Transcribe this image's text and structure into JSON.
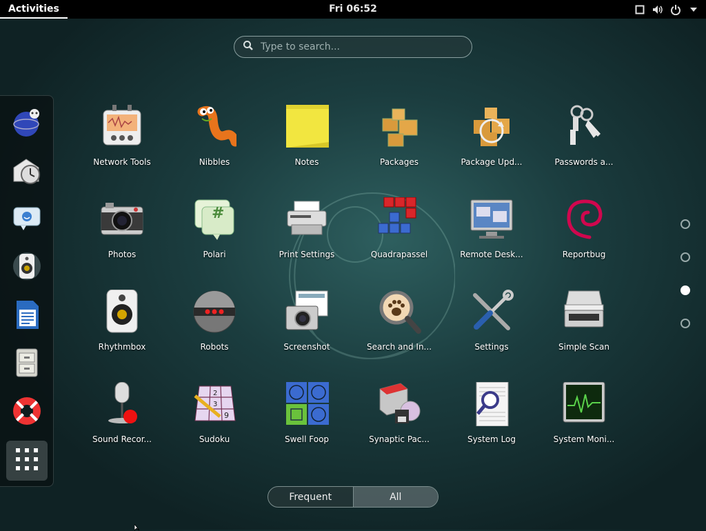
{
  "topbar": {
    "activities_label": "Activities",
    "clock": "Fri 06:52",
    "tray_icons": [
      "window-icon",
      "volume-icon",
      "power-icon",
      "chevron-down-icon"
    ]
  },
  "search": {
    "placeholder": "Type to search..."
  },
  "dash": {
    "items": [
      "web-browser-icon",
      "evolution-mail-icon",
      "empathy-chat-icon",
      "rhythmbox-speaker-icon",
      "writer-document-icon",
      "file-cabinet-icon",
      "help-lifebuoy-icon"
    ],
    "show_apps_icon": "grid-icon"
  },
  "apps": [
    {
      "label": "Network Tools",
      "icon": "network-tools-icon"
    },
    {
      "label": "Nibbles",
      "icon": "nibbles-worm-icon"
    },
    {
      "label": "Notes",
      "icon": "notes-icon"
    },
    {
      "label": "Packages",
      "icon": "packages-icon"
    },
    {
      "label": "Package Upd...",
      "icon": "package-updater-icon"
    },
    {
      "label": "Passwords a...",
      "icon": "keys-icon"
    },
    {
      "label": "Photos",
      "icon": "camera-icon"
    },
    {
      "label": "Polari",
      "icon": "chat-hash-icon"
    },
    {
      "label": "Print Settings",
      "icon": "printer-icon"
    },
    {
      "label": "Quadrapassel",
      "icon": "tetris-blocks-icon"
    },
    {
      "label": "Remote Desk...",
      "icon": "remote-desktop-icon"
    },
    {
      "label": "Reportbug",
      "icon": "debian-swirl-icon"
    },
    {
      "label": "Rhythmbox",
      "icon": "speaker-icon"
    },
    {
      "label": "Robots",
      "icon": "robot-icon"
    },
    {
      "label": "Screenshot",
      "icon": "screenshot-camera-icon"
    },
    {
      "label": "Search and In...",
      "icon": "magnifier-paw-icon"
    },
    {
      "label": "Settings",
      "icon": "settings-tools-icon"
    },
    {
      "label": "Simple Scan",
      "icon": "scanner-icon"
    },
    {
      "label": "Sound Recor...",
      "icon": "microphone-icon"
    },
    {
      "label": "Sudoku",
      "icon": "sudoku-grid-icon"
    },
    {
      "label": "Swell Foop",
      "icon": "swell-foop-icon"
    },
    {
      "label": "Synaptic Pac...",
      "icon": "synaptic-icon"
    },
    {
      "label": "System Log",
      "icon": "system-log-icon"
    },
    {
      "label": "System Moni...",
      "icon": "system-monitor-icon"
    }
  ],
  "pages": {
    "count": 4,
    "current": 3
  },
  "view_switch": {
    "frequent_label": "Frequent",
    "all_label": "All",
    "selected": "All"
  }
}
